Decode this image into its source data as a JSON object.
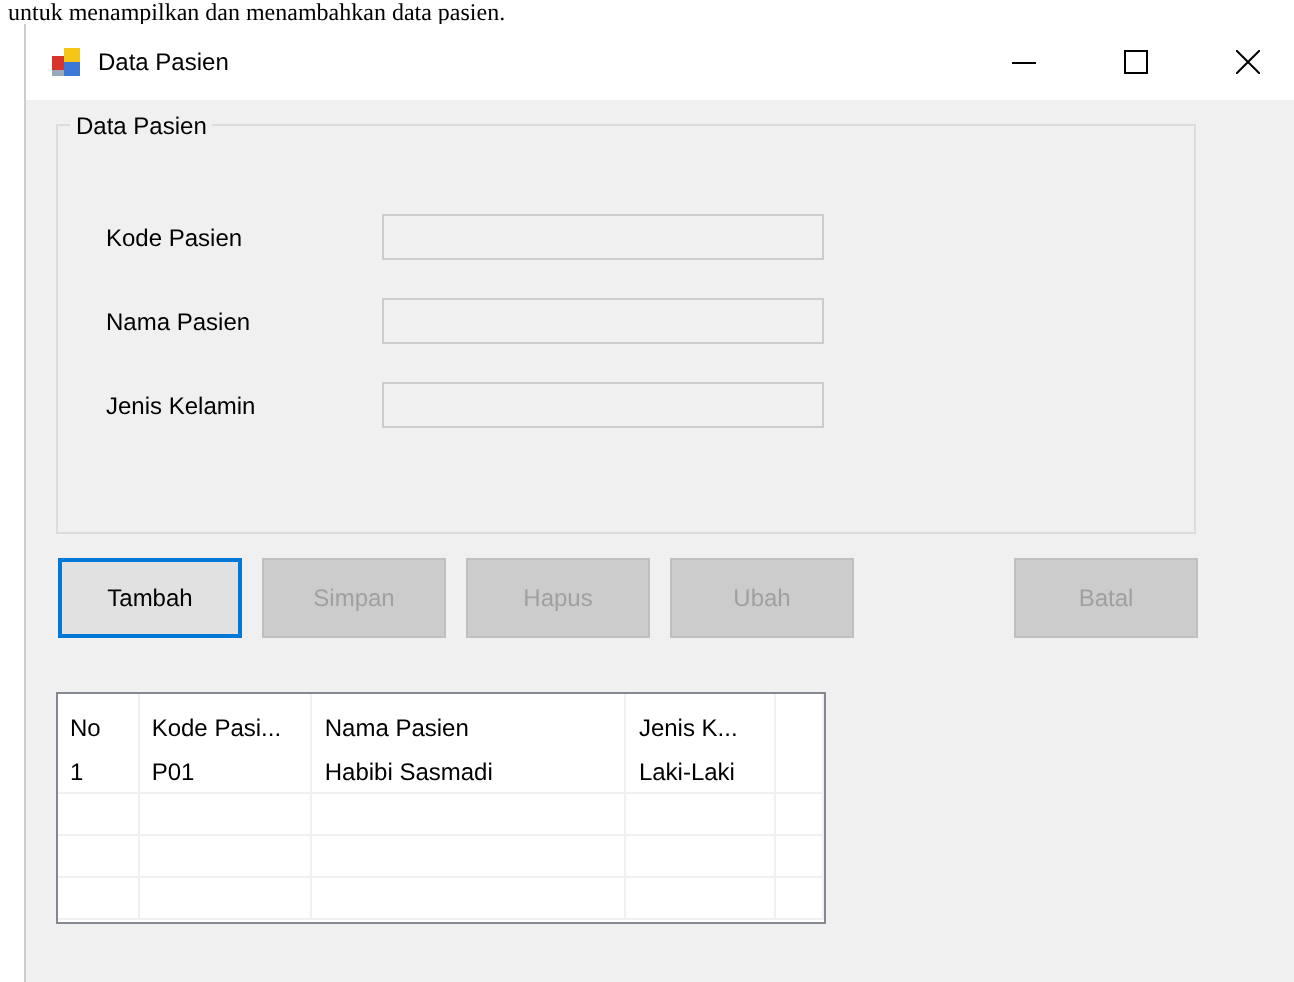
{
  "document_text": "untuk menampilkan dan menambahkan data pasien.",
  "window": {
    "title": "Data Pasien"
  },
  "group": {
    "title": "Data Pasien",
    "fields": [
      {
        "label": "Kode Pasien",
        "disabled": true
      },
      {
        "label": "Nama Pasien",
        "disabled": true
      },
      {
        "label": "Jenis Kelamin",
        "disabled": true
      }
    ]
  },
  "buttons": [
    {
      "label": "Tambah",
      "disabled": false,
      "focused": true
    },
    {
      "label": "Simpan",
      "disabled": true,
      "focused": false
    },
    {
      "label": "Hapus",
      "disabled": true,
      "focused": false
    },
    {
      "label": "Ubah",
      "disabled": true,
      "focused": false
    },
    {
      "label": "Batal",
      "disabled": true,
      "focused": false
    }
  ],
  "table": {
    "columns": [
      "No",
      "Kode Pasi...",
      "Nama Pasien",
      "Jenis K..."
    ],
    "rows": [
      [
        "1",
        "P01",
        "Habibi Sasmadi",
        "Laki-Laki"
      ]
    ]
  }
}
